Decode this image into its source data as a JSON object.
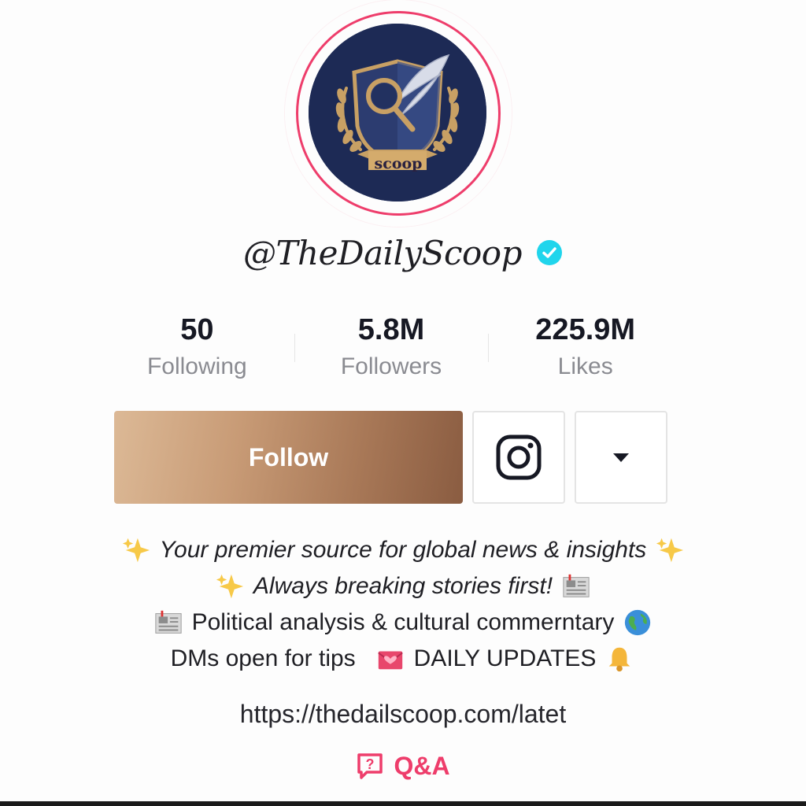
{
  "profile": {
    "handle": "@TheDailyScoop",
    "avatar_text": "scoop",
    "verified_icon": "verified-badge-icon"
  },
  "stats": [
    {
      "value": "50",
      "label": "Following"
    },
    {
      "value": "5.8M",
      "label": "Followers"
    },
    {
      "value": "225.9M",
      "label": "Likes"
    }
  ],
  "actions": {
    "follow_label": "Follow",
    "instagram_icon": "instagram-icon",
    "more_icon": "caret-down-icon"
  },
  "bio": {
    "line1": "Your premier source for global news & insights",
    "line2": "Always breaking stories first!",
    "line3": "Political analysis & cultural commerntary",
    "line4a": "DMs open for tips",
    "line4b": "DAILY UPDATES"
  },
  "link": "https://thedailscoop.com/latet",
  "qa_label": "Q&A",
  "colors": {
    "accent": "#ee3d6b",
    "verified": "#20d5ec",
    "follow_gradient_start": "#dcb996",
    "follow_gradient_end": "#8a5c41",
    "avatar_bg": "#1d2a55",
    "crest_gold": "#c8a064"
  }
}
